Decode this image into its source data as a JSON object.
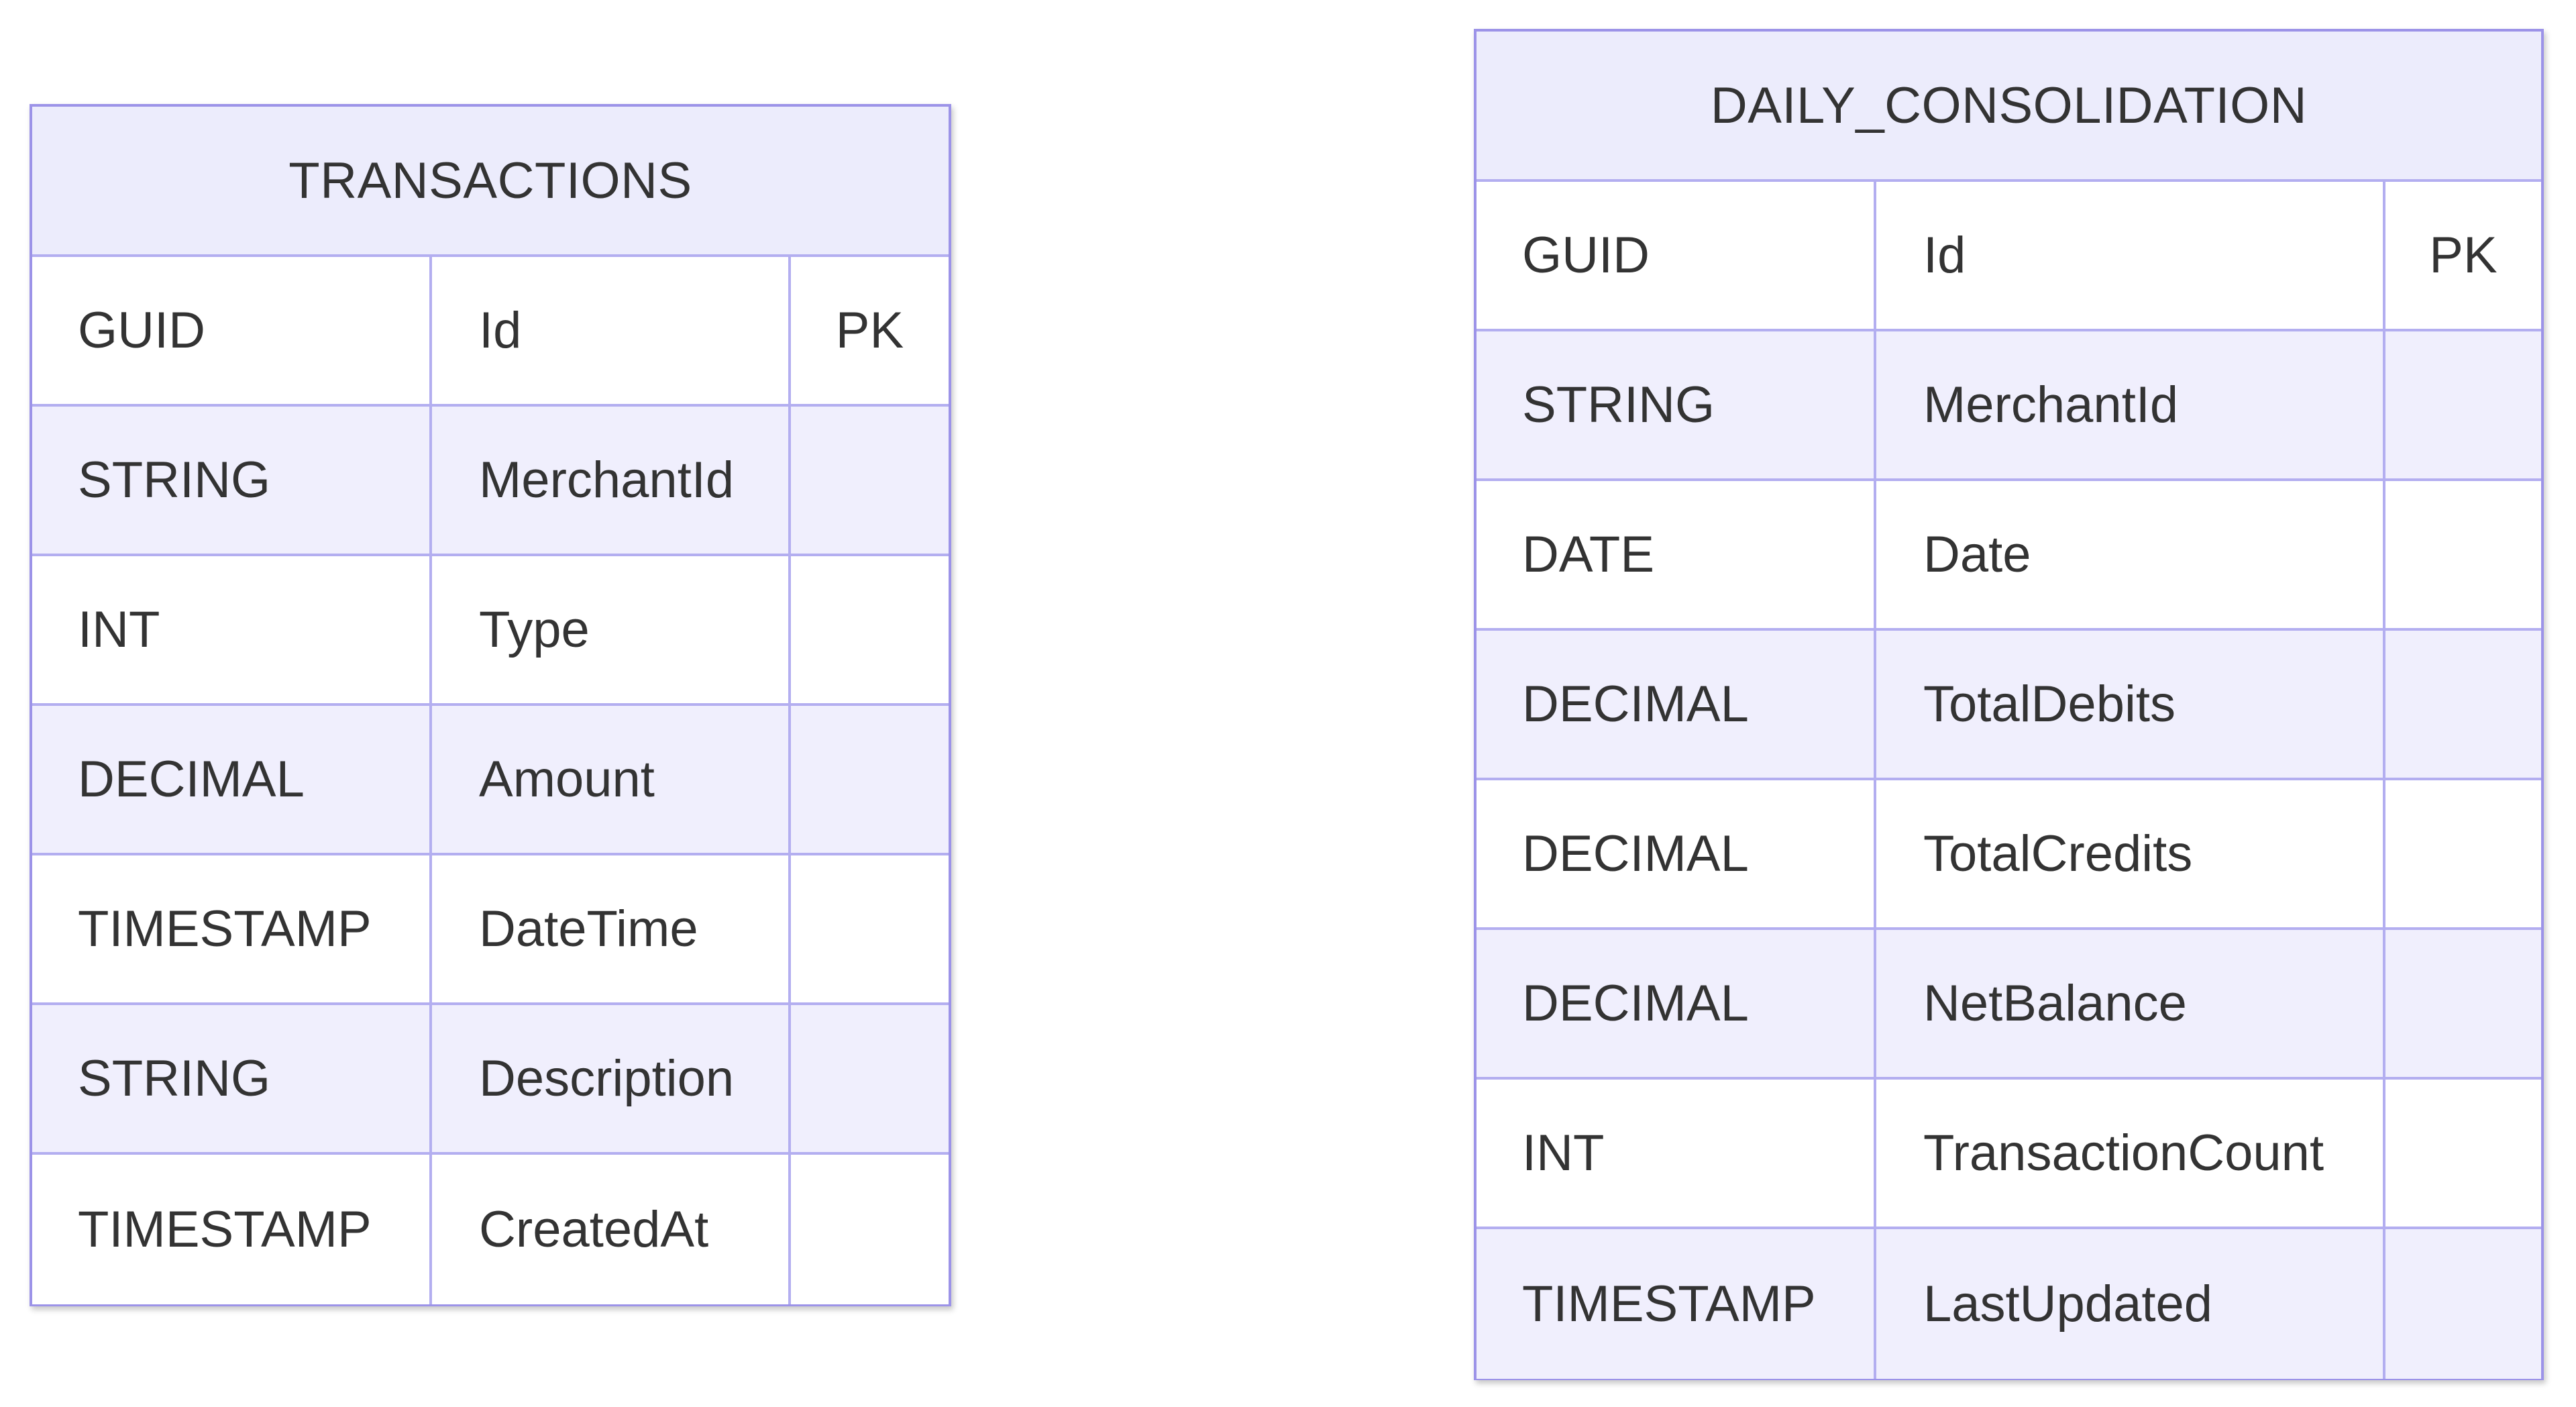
{
  "entities": [
    {
      "name": "TRANSACTIONS",
      "attributes": [
        {
          "type": "GUID",
          "name": "Id",
          "key": "PK"
        },
        {
          "type": "STRING",
          "name": "MerchantId",
          "key": ""
        },
        {
          "type": "INT",
          "name": "Type",
          "key": ""
        },
        {
          "type": "DECIMAL",
          "name": "Amount",
          "key": ""
        },
        {
          "type": "TIMESTAMP",
          "name": "DateTime",
          "key": ""
        },
        {
          "type": "STRING",
          "name": "Description",
          "key": ""
        },
        {
          "type": "TIMESTAMP",
          "name": "CreatedAt",
          "key": ""
        }
      ]
    },
    {
      "name": "DAILY_CONSOLIDATION",
      "attributes": [
        {
          "type": "GUID",
          "name": "Id",
          "key": "PK"
        },
        {
          "type": "STRING",
          "name": "MerchantId",
          "key": ""
        },
        {
          "type": "DATE",
          "name": "Date",
          "key": ""
        },
        {
          "type": "DECIMAL",
          "name": "TotalDebits",
          "key": ""
        },
        {
          "type": "DECIMAL",
          "name": "TotalCredits",
          "key": ""
        },
        {
          "type": "DECIMAL",
          "name": "NetBalance",
          "key": ""
        },
        {
          "type": "INT",
          "name": "TransactionCount",
          "key": ""
        },
        {
          "type": "TIMESTAMP",
          "name": "LastUpdated",
          "key": ""
        }
      ]
    }
  ],
  "colors": {
    "header_bg": "#ececfc",
    "row_alt_bg": "#f0effd",
    "border": "#9c93e8",
    "text": "#333333"
  }
}
